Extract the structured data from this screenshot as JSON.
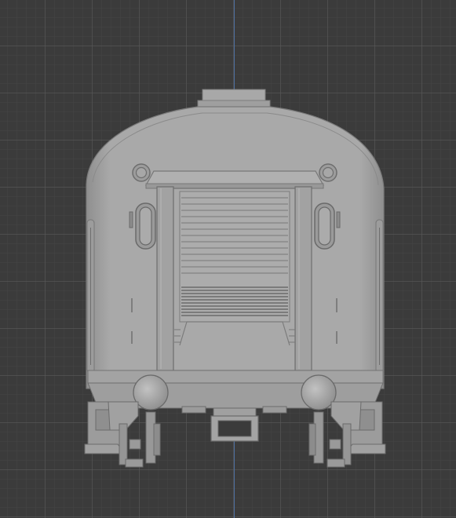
{
  "viewport": {
    "background_color": "#3b3b3b",
    "grid_color": "#5a5a5a",
    "axis_color": "#4d6f9f",
    "model_color": "#a6a6a6",
    "model_shadow_color": "#7a7a7a",
    "model_dark_color": "#555555"
  },
  "model": {
    "object": "railcar-rear-end"
  }
}
